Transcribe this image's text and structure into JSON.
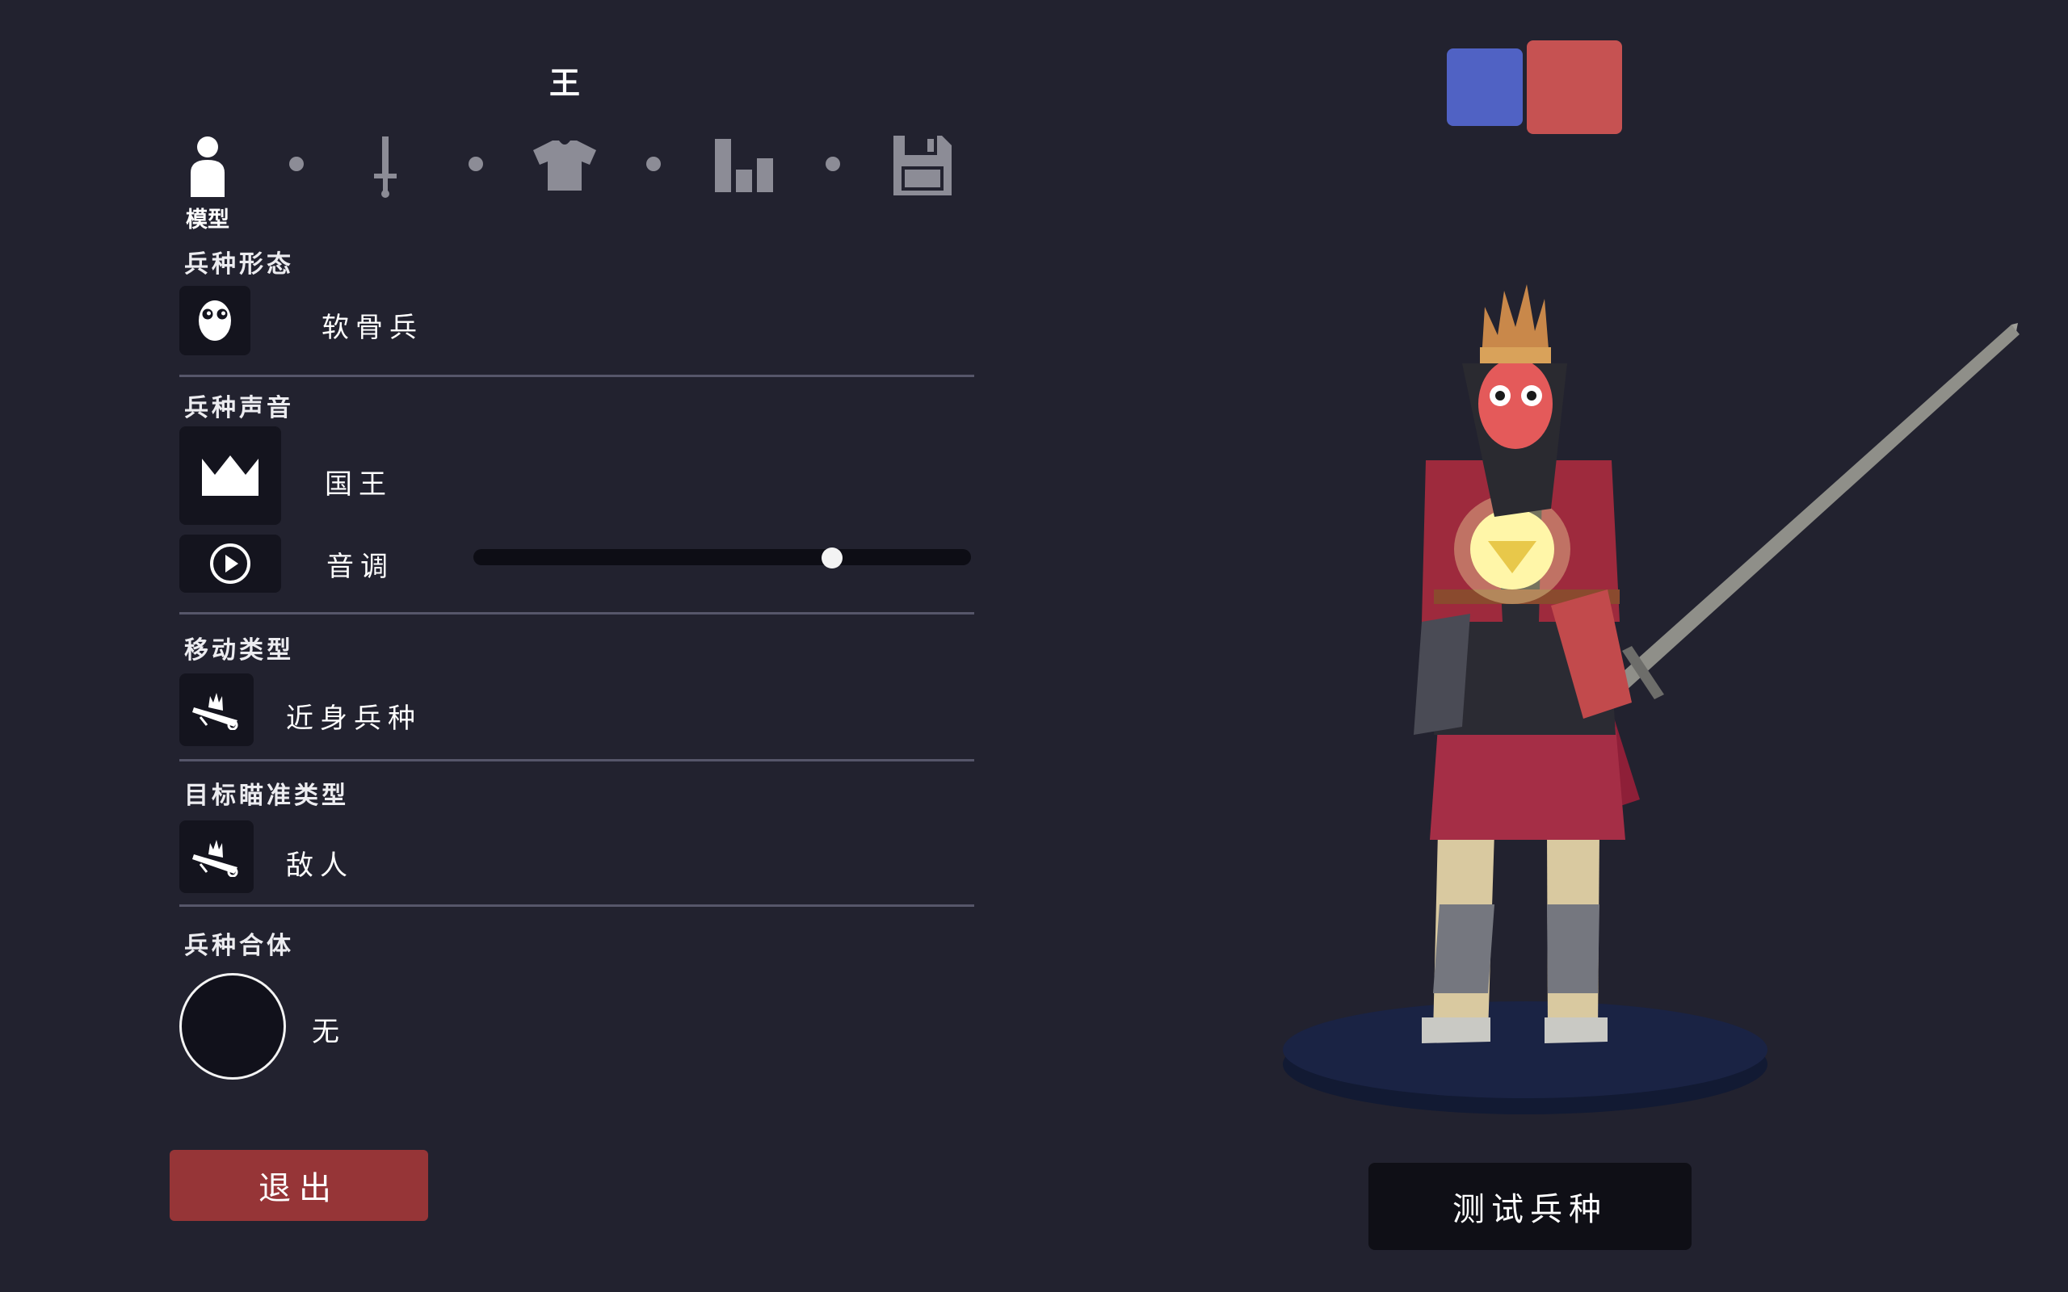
{
  "header": {
    "unit_name": "王"
  },
  "nav": {
    "steps": [
      {
        "icon": "person-icon",
        "label": "模型"
      },
      {
        "icon": "sword-icon"
      },
      {
        "icon": "shirt-icon"
      },
      {
        "icon": "stats-icon"
      },
      {
        "icon": "save-icon"
      }
    ],
    "active_label": "模型"
  },
  "sections": {
    "form": {
      "title": "兵种形态",
      "icon": "face-icon",
      "value": "软骨兵"
    },
    "voice": {
      "title": "兵种声音",
      "icon": "crown-icon",
      "value": "国王",
      "pitch_icon": "play-icon",
      "pitch_label": "音调",
      "pitch_value": 0.72
    },
    "movement": {
      "title": "移动类型",
      "icon": "unit-icon",
      "value": "近身兵种"
    },
    "targeting": {
      "title": "目标瞄准类型",
      "icon": "unit-icon",
      "value": "敌人"
    },
    "combine": {
      "title": "兵种合体",
      "value": "无"
    }
  },
  "buttons": {
    "exit": "退出",
    "test": "测试兵种"
  },
  "teams": [
    {
      "name": "blue",
      "color": "#5062c4"
    },
    {
      "name": "red",
      "color": "#c65252",
      "selected": true
    }
  ]
}
